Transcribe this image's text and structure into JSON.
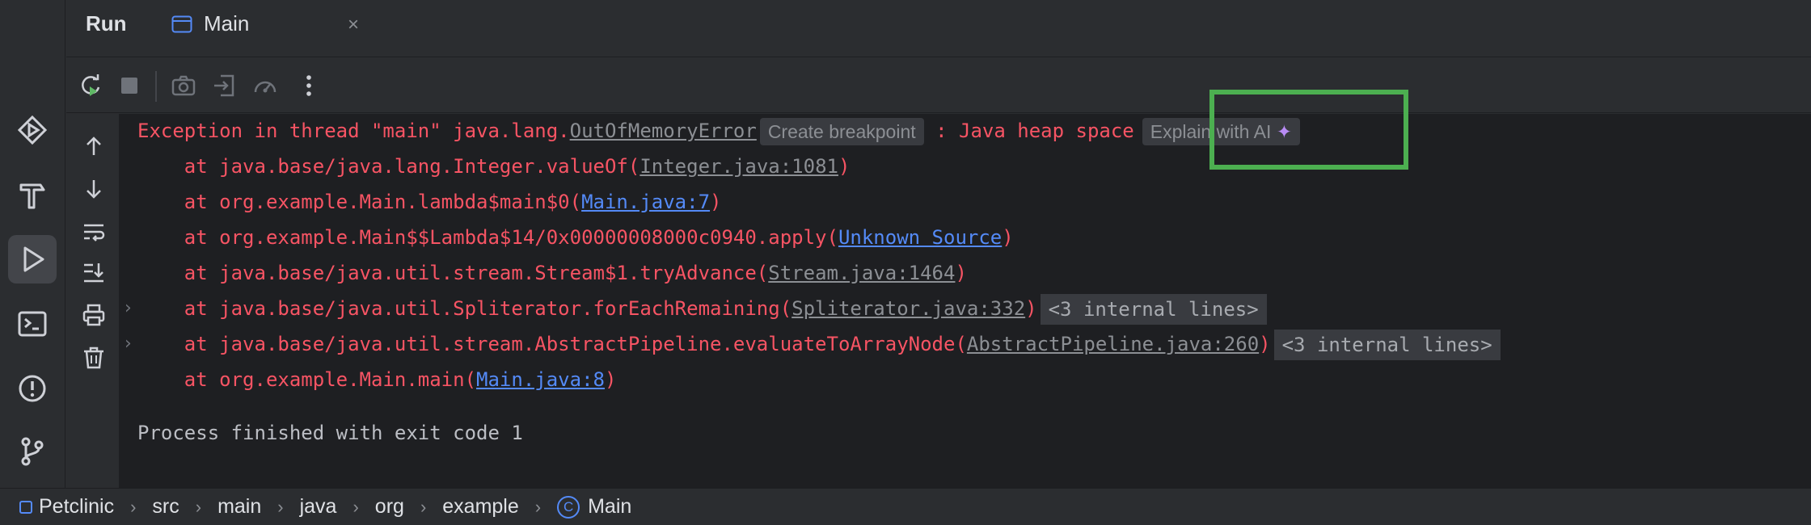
{
  "header": {
    "panel_label": "Run",
    "tab": {
      "label": "Main",
      "close_glyph": "×"
    }
  },
  "leftbar": {
    "items": [
      {
        "icon": "services-icon"
      },
      {
        "icon": "build-hammer-icon"
      },
      {
        "icon": "run-icon",
        "active": true
      },
      {
        "icon": "terminal-icon"
      },
      {
        "icon": "problems-icon"
      },
      {
        "icon": "git-icon"
      }
    ]
  },
  "toolbar": {
    "buttons": [
      "rerun-icon",
      "stop-icon",
      "screenshot-icon",
      "restore-layout-icon",
      "profiler-icon",
      "more-options-icon"
    ]
  },
  "side_actions": [
    "scroll-up-icon",
    "scroll-down-icon",
    "soft-wrap-icon",
    "scroll-to-end-icon",
    "print-icon",
    "clear-all-icon"
  ],
  "console": {
    "exception_prefix": "Exception in thread \"main\" java.lang.",
    "exception_class": "OutOfMemoryError",
    "create_breakpoint": "Create breakpoint",
    "exception_suffix": " : Java heap space",
    "explain_ai": "Explain with AI",
    "spark_glyph": "✦",
    "frames": [
      {
        "prefix": "    at java.base/java.lang.Integer.valueOf(",
        "link": "Integer.java:1081",
        "link_type": "gray",
        "suffix": ")"
      },
      {
        "prefix": "    at org.example.Main.lambda$main$0(",
        "link": "Main.java:7",
        "link_type": "blue",
        "suffix": ")"
      },
      {
        "prefix": "    at org.example.Main$$Lambda$14/0x00000008000c0940.apply(",
        "link": "Unknown Source",
        "link_type": "blue",
        "suffix": ")"
      },
      {
        "prefix": "    at java.base/java.util.stream.Stream$1.tryAdvance(",
        "link": "Stream.java:1464",
        "link_type": "gray",
        "suffix": ")"
      },
      {
        "prefix": "    at java.base/java.util.Spliterator.forEachRemaining(",
        "link": "Spliterator.java:332",
        "link_type": "gray",
        "suffix": ")",
        "internal": "<3 internal lines>"
      },
      {
        "prefix": "    at java.base/java.util.stream.AbstractPipeline.evaluateToArrayNode(",
        "link": "AbstractPipeline.java:260",
        "link_type": "gray",
        "suffix": ")",
        "internal": "<3 internal lines>"
      },
      {
        "prefix": "    at org.example.Main.main(",
        "link": "Main.java:8",
        "link_type": "blue",
        "suffix": ")"
      }
    ],
    "fold_glyph": "›",
    "exit_message": "Process finished with exit code 1"
  },
  "breadcrumb": {
    "items": [
      "Petclinic",
      "src",
      "main",
      "java",
      "org",
      "example",
      "Main"
    ],
    "class_glyph": "C",
    "separator": "›"
  },
  "colors": {
    "error": "#f75464",
    "link_blue": "#548af7",
    "highlight": "#4caf50"
  }
}
